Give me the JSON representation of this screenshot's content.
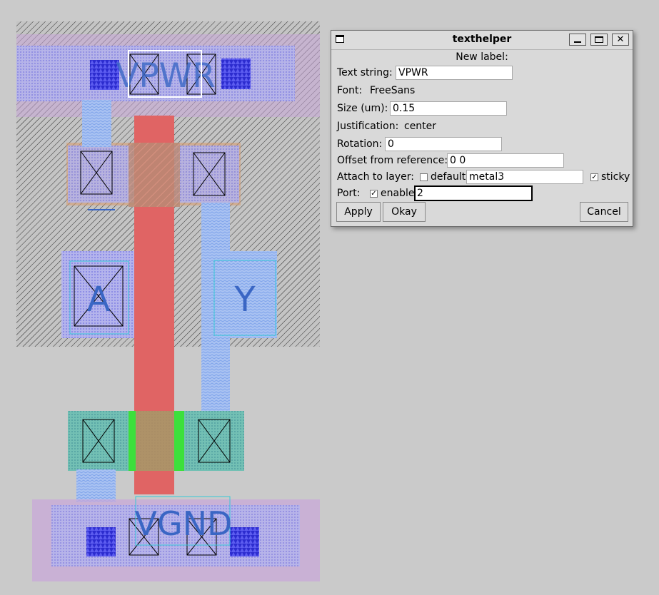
{
  "layout": {
    "labels": {
      "vpwr": "VPWR",
      "a": "A",
      "y": "Y",
      "vgnd": "VGND"
    }
  },
  "dialog": {
    "title": "texthelper",
    "heading": "New label:",
    "text_string": {
      "label": "Text string:",
      "value": "VPWR"
    },
    "font": {
      "label": "Font:",
      "value": "FreeSans"
    },
    "size": {
      "label": "Size (um):",
      "value": "0.15"
    },
    "justification": {
      "label": "Justification:",
      "value": "center"
    },
    "rotation": {
      "label": "Rotation:",
      "value": "0"
    },
    "offset": {
      "label": "Offset from reference:",
      "value": "0 0"
    },
    "attach": {
      "label": "Attach to layer:",
      "default_label": "default",
      "default_checked": false,
      "layer_value": "metal3",
      "sticky_label": "sticky",
      "sticky_checked": true
    },
    "port": {
      "label": "Port:",
      "enable_label": "enable",
      "enable_checked": true,
      "value": "2"
    },
    "buttons": {
      "apply": "Apply",
      "okay": "Okay",
      "cancel": "Cancel"
    }
  }
}
